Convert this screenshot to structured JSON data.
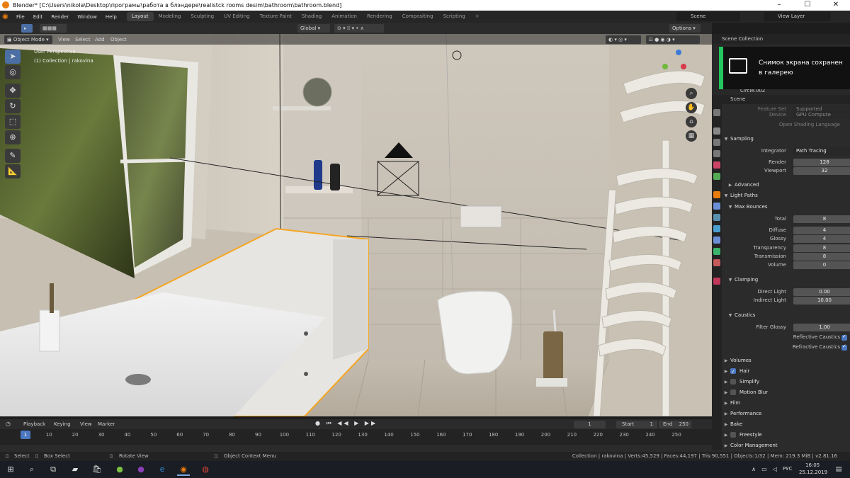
{
  "window": {
    "title": "Blender* [C:\\Users\\nikola\\Desktop\\програмы\\работа в блэндере\\realistck rooms desim\\bathroom\\bathroom.blend]"
  },
  "menu": [
    "File",
    "Edit",
    "Render",
    "Window",
    "Help"
  ],
  "workspaces": [
    "Layout",
    "Modeling",
    "Sculpting",
    "UV Editing",
    "Texture Paint",
    "Shading",
    "Animation",
    "Rendering",
    "Compositing",
    "Scripting"
  ],
  "active_workspace": "Layout",
  "scene_selector": "Scene",
  "view_layer_selector": "View Layer",
  "viewport_header": {
    "mode": "Object Mode",
    "menus": [
      "View",
      "Select",
      "Add",
      "Object"
    ],
    "transform_orientation": "Global",
    "options": "Options"
  },
  "viewport_overlay": {
    "perspective": "User Perspective",
    "collection": "(1) Collection | rakovina"
  },
  "outliner": {
    "title": "Scene Collection",
    "visible_item": "Circle.002"
  },
  "toast": {
    "text_line1": "Снимок экрана сохранен",
    "text_line2": "в галерею"
  },
  "properties": {
    "context": "Scene",
    "partial_row_top": "Feature Set",
    "partial_row_top_value": "Supported",
    "device_label": "Device",
    "device_value": "GPU Compute",
    "osl_label": "Open Shading Language",
    "sampling": {
      "title": "Sampling",
      "integrator_label": "Integrator",
      "integrator_value": "Path Tracing",
      "render_label": "Render",
      "render_value": "128",
      "viewport_label": "Viewport",
      "viewport_value": "32",
      "advanced": "Advanced"
    },
    "light_paths": {
      "title": "Light Paths",
      "max_bounces": "Max Bounces",
      "rows": [
        {
          "label": "Total",
          "value": "8"
        },
        {
          "label": "Diffuse",
          "value": "4"
        },
        {
          "label": "Glossy",
          "value": "4"
        },
        {
          "label": "Transparency",
          "value": "8"
        },
        {
          "label": "Transmission",
          "value": "8"
        },
        {
          "label": "Volume",
          "value": "0"
        }
      ],
      "clamping": "Clamping",
      "direct_light_label": "Direct Light",
      "direct_light_value": "0.00",
      "indirect_light_label": "Indirect Light",
      "indirect_light_value": "10.00",
      "caustics": "Caustics",
      "filter_glossy_label": "Filter Glossy",
      "filter_glossy_value": "1.00",
      "reflective_caustics": "Reflective Caustics",
      "refractive_caustics": "Refractive Caustics"
    },
    "panels": [
      {
        "label": "Volumes",
        "checkbox": null
      },
      {
        "label": "Hair",
        "checkbox": true
      },
      {
        "label": "Simplify",
        "checkbox": false
      },
      {
        "label": "Motion Blur",
        "checkbox": false
      },
      {
        "label": "Film",
        "checkbox": null
      },
      {
        "label": "Performance",
        "checkbox": null
      },
      {
        "label": "Bake",
        "checkbox": null
      },
      {
        "label": "Freestyle",
        "checkbox": false
      },
      {
        "label": "Color Management",
        "checkbox": null
      }
    ]
  },
  "timeline": {
    "menus": [
      "Playback",
      "Keying",
      "View",
      "Marker"
    ],
    "current_frame": "1",
    "start_label": "Start",
    "start_value": "1",
    "end_label": "End",
    "end_value": "250",
    "ticks": [
      "1",
      "10",
      "20",
      "30",
      "40",
      "50",
      "60",
      "70",
      "80",
      "90",
      "100",
      "110",
      "120",
      "130",
      "140",
      "150",
      "160",
      "170",
      "180",
      "190",
      "200",
      "210",
      "220",
      "230",
      "240",
      "250"
    ]
  },
  "statusbar": {
    "select": "Select",
    "box_select": "Box Select",
    "rotate_view": "Rotate View",
    "context_menu": "Object Context Menu",
    "stats": "Collection | rakovina | Verts:45,529 | Faces:44,197 | Tris:90,551 | Objects:1/32 | Mem: 219.3 MiB | v2.81.16"
  },
  "taskbar": {
    "lang": "РУС",
    "time": "16:05",
    "date": "25.12.2019"
  },
  "colors": {
    "accent": "#4b78c0",
    "selection_outline": "#f5a623",
    "active_tab": "#3d3d3d"
  }
}
